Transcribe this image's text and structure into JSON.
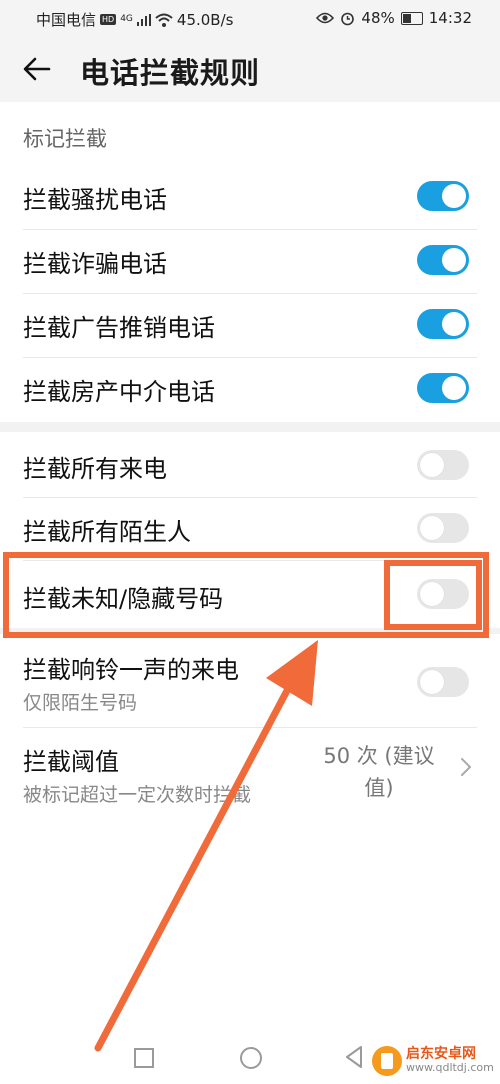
{
  "status_bar": {
    "carrier": "中国电信",
    "hd": "HD",
    "network": "4G",
    "speed": "45.0B/s",
    "battery": "48%",
    "battery_fraction": 0.48,
    "time": "14:32"
  },
  "header": {
    "title": "电话拦截规则"
  },
  "section": {
    "title": "标记拦截"
  },
  "group1": [
    {
      "label": "拦截骚扰电话",
      "on": true
    },
    {
      "label": "拦截诈骗电话",
      "on": true
    },
    {
      "label": "拦截广告推销电话",
      "on": true
    },
    {
      "label": "拦截房产中介电话",
      "on": true
    }
  ],
  "group2": [
    {
      "label": "拦截所有来电",
      "on": false
    },
    {
      "label": "拦截所有陌生人",
      "on": false
    },
    {
      "label": "拦截未知/隐藏号码",
      "on": false
    }
  ],
  "ring_once": {
    "label": "拦截响铃一声的来电",
    "sublabel": "仅限陌生号码",
    "on": false
  },
  "threshold": {
    "label": "拦截阈值",
    "sublabel": "被标记超过一定次数时拦截",
    "value_line1": "50 次 (建议",
    "value_line2": "值)"
  },
  "watermark": {
    "name": "启东安卓网",
    "url": "www.qdltdj.com"
  },
  "colors": {
    "accent": "#1a9fe0",
    "annotation": "#f06a3a"
  }
}
